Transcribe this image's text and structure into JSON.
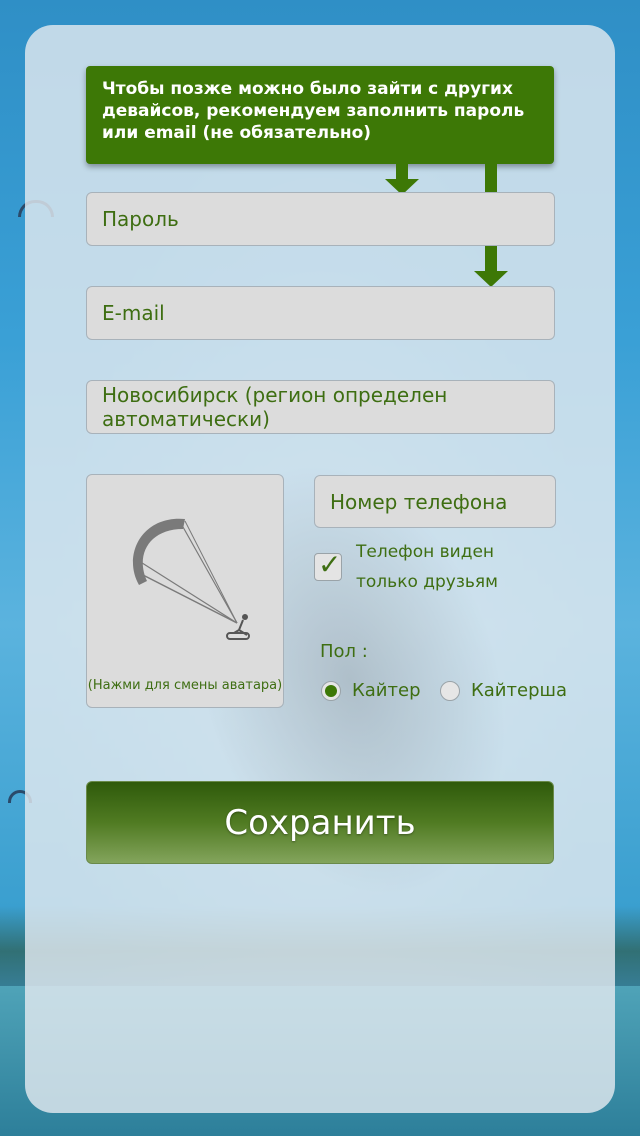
{
  "hint": {
    "text": "Чтобы позже можно было зайти с других девайсов, рекомендуем заполнить пароль или email (не обязательно)"
  },
  "form": {
    "password_placeholder": "Пароль",
    "email_placeholder": "E-mail",
    "region_value": "Новосибирск (регион определен автоматически)",
    "phone_placeholder": "Номер телефона"
  },
  "avatar": {
    "caption": "(Нажми для смены аватара)",
    "icon": "kitesurfer-icon"
  },
  "phone_visibility": {
    "label": "Телефон виден только друзьям",
    "checked": true
  },
  "gender": {
    "label": "Пол :",
    "options": [
      {
        "label": "Кайтер",
        "selected": true
      },
      {
        "label": "Кайтерша",
        "selected": false
      }
    ]
  },
  "save_button": {
    "label": "Сохранить"
  },
  "colors": {
    "accent": "#3d7806",
    "text": "#3e6e12",
    "field_bg": "#dcdcdc"
  }
}
